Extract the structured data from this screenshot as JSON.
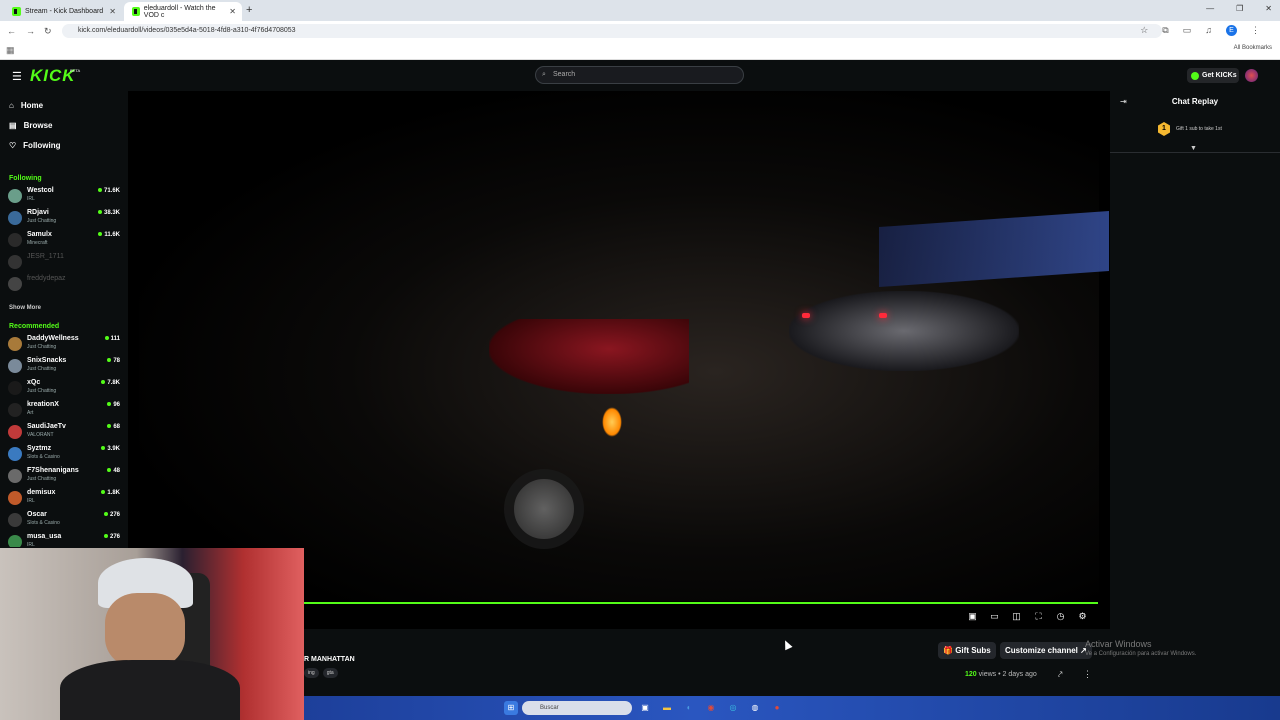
{
  "browser": {
    "tabs": [
      {
        "label": "Stream - Kick Dashboard",
        "active": false
      },
      {
        "label": "eleduardoll - Watch the VOD c",
        "active": true
      }
    ],
    "url": "kick.com/eleduardoll/videos/035e5d4a-5018-4fd8-a310-4f76d4708053",
    "profile_initial": "E",
    "all_bookmarks": "All Bookmarks"
  },
  "header": {
    "logo": "KICK",
    "logo_badge": "BETA",
    "search_placeholder": "Search",
    "get_kicks": "Get KICKs"
  },
  "sidebar": {
    "nav": [
      {
        "label": "Home",
        "icon": "home-icon"
      },
      {
        "label": "Browse",
        "icon": "browse-icon"
      },
      {
        "label": "Following",
        "icon": "heart-icon"
      }
    ],
    "following_title": "Following",
    "following": [
      {
        "name": "Westcol",
        "category": "IRL",
        "viewers": "71.6K",
        "color": "#6a9e8a",
        "online": true
      },
      {
        "name": "RDjavi",
        "category": "Just Chatting",
        "viewers": "38.3K",
        "color": "#3a6a9a",
        "online": true
      },
      {
        "name": "Samulx",
        "category": "Minecraft",
        "viewers": "11.6K",
        "color": "#2a2a2a",
        "online": true
      },
      {
        "name": "JESR_1711",
        "category": "",
        "viewers": "",
        "color": "#333",
        "online": false
      },
      {
        "name": "freddydepaz",
        "category": "",
        "viewers": "",
        "color": "#444",
        "online": false
      }
    ],
    "show_more": "Show More",
    "recommended_title": "Recommended",
    "recommended": [
      {
        "name": "DaddyWellness",
        "category": "Just Chatting",
        "viewers": "111",
        "color": "#a87a3a"
      },
      {
        "name": "SnixSnacks",
        "category": "Just Chatting",
        "viewers": "78",
        "color": "#7a8a9a"
      },
      {
        "name": "xQc",
        "category": "Just Chatting",
        "viewers": "7.8K",
        "color": "#1a1a1a"
      },
      {
        "name": "kreationX",
        "category": "Art",
        "viewers": "96",
        "color": "#222"
      },
      {
        "name": "SaudiJaeTv",
        "category": "VALORANT",
        "viewers": "68",
        "color": "#c03a3a"
      },
      {
        "name": "Syztmz",
        "category": "Slots & Casino",
        "viewers": "3.9K",
        "color": "#3a7ac0"
      },
      {
        "name": "F7Shenanigans",
        "category": "Just Chatting",
        "viewers": "48",
        "color": "#6a6a6a"
      },
      {
        "name": "demisux",
        "category": "IRL",
        "viewers": "1.8K",
        "color": "#c05a2a"
      },
      {
        "name": "Oscar",
        "category": "Slots & Casino",
        "viewers": "276",
        "color": "#3a3a3a"
      },
      {
        "name": "musa_usa",
        "category": "IRL",
        "viewers": "276",
        "color": "#3a8a4a"
      }
    ]
  },
  "player": {
    "progress": 1.0,
    "controls": [
      "miniplayer-icon",
      "theater-icon",
      "pip-icon",
      "fullscreen-icon",
      "speed-icon",
      "settings-icon"
    ]
  },
  "chat": {
    "title": "Chat Replay",
    "gift_badge": "1",
    "gift_text": "Gift 1 sub to take 1st"
  },
  "video_info": {
    "title": "R MANHATTAN",
    "tags": [
      "ing",
      "gta"
    ],
    "gift_subs": "Gift Subs",
    "customize": "Customize channel",
    "views_count": "120",
    "views_label": "views",
    "age": "2 days ago",
    "watermark_line1": "Activar Windows",
    "watermark_line2": "Ve a Configuración para activar Windows."
  },
  "taskbar": {
    "search_placeholder": "Buscar"
  }
}
